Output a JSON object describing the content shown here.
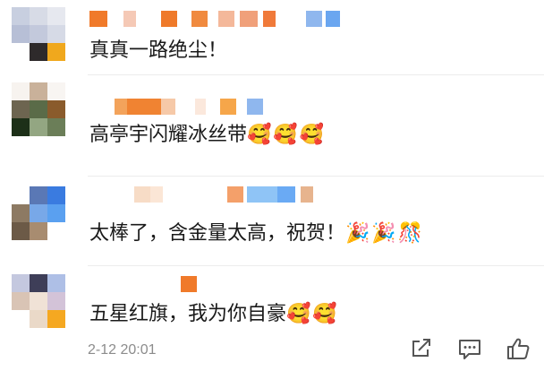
{
  "comments": [
    {
      "text": "真真一路绝尘！",
      "emoji": "",
      "avatar_colors": [
        "#c8cfe0",
        "#d7dbe6",
        "#e6e8ef",
        "#b7bfd6",
        "#c3c9dc",
        "#d6dae6",
        "#ffffff",
        "#2e2a2b",
        "#f0a81d"
      ],
      "name_colors": [
        "#f07a2a",
        "#f5c9b6",
        "#ef7a2a",
        "#f08a3f",
        "#f4b89a",
        "#f0a07a",
        "#f07a3a",
        "#8fb7ee",
        "#6aa6f0"
      ]
    },
    {
      "text": "高亭宇闪耀冰丝带",
      "emoji": "🥰🥰🥰",
      "avatar_colors": [
        "#f7f3ef",
        "#c9b19a",
        "#f8f5f2",
        "#6d6550",
        "#5a6b48",
        "#8a5b2c",
        "#1d3018",
        "#93a682",
        "#6b7e58"
      ],
      "name_colors": [
        "#f3a35b",
        "#f08332",
        "#f6c9a8",
        "#fbe8dc",
        "#f6a64a",
        "#8fb7ee"
      ]
    },
    {
      "text": "太棒了，含金量太高，祝贺！",
      "emoji": "🎉🎉🎊",
      "avatar_colors": [
        "#ffffff",
        "#5a78b5",
        "#3a7be0",
        "#8d7a63",
        "#78a8e8",
        "#5aa0f0",
        "#6c5a47",
        "#a88c70",
        "#ffffff"
      ],
      "name_colors": [
        "#f7dcc6",
        "#fbe6d6",
        "#f4a06a",
        "#8fc4f6",
        "#6aaaf4",
        "#e7b48e"
      ]
    },
    {
      "text": "五星红旗，我为你自豪",
      "emoji": "🥰🥰",
      "avatar_colors": [
        "#c4c8df",
        "#3e3e58",
        "#aebfe6",
        "#d9c4b5",
        "#f0e2d6",
        "#d3c3d8",
        "#ffffff",
        "#ead9c8",
        "#f5a821"
      ],
      "name_colors": [
        "#f07a2a"
      ],
      "time": "2-12 20:01"
    }
  ],
  "icons": {
    "share": "share-icon",
    "comment": "comment-icon",
    "like": "thumbs-up-icon"
  }
}
